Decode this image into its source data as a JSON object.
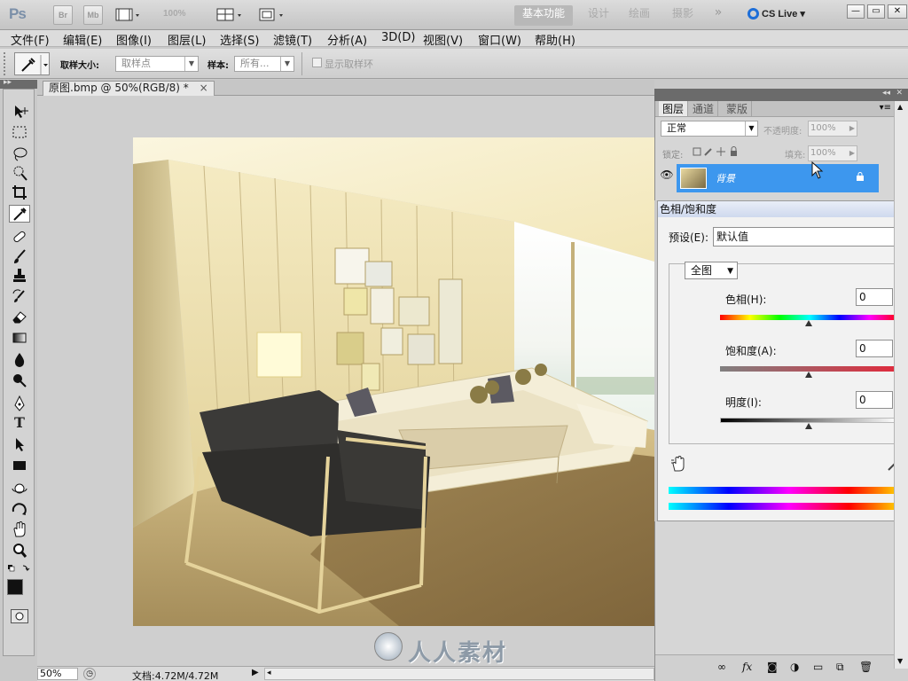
{
  "app": {
    "logo": "Ps"
  },
  "titlebar": {
    "bridge_label": "Br",
    "minibridge_label": "Mb",
    "zoom_value": "100%",
    "workspaces": [
      "基本功能",
      "设计",
      "绘画",
      "摄影"
    ],
    "more": "»",
    "cs_live": "CS Live",
    "window_controls": {
      "minimize": "—",
      "restore": "▭",
      "close": "✕"
    }
  },
  "menu": [
    "文件(F)",
    "编辑(E)",
    "图像(I)",
    "图层(L)",
    "选择(S)",
    "滤镜(T)",
    "分析(A)",
    "3D(D)",
    "视图(V)",
    "窗口(W)",
    "帮助(H)"
  ],
  "options": {
    "sample_size_label": "取样大小:",
    "sample_size_value": "取样点",
    "sample_label": "样本:",
    "sample_value": "所有...",
    "show_ring_label": "显示取样环"
  },
  "document": {
    "tab_title": "原图.bmp @ 50%(RGB/8) *",
    "close": "×",
    "watermark": "人人素材",
    "zoom": "50%",
    "doc_info": "文档:4.72M/4.72M"
  },
  "layers_panel": {
    "tabs": [
      "图层",
      "通道",
      "蒙版"
    ],
    "blend_mode": "正常",
    "opacity_label": "不透明度:",
    "opacity": "100%",
    "lock_label": "锁定:",
    "fill_label": "填充:",
    "fill": "100%",
    "layer_name": "背景"
  },
  "hue_sat": {
    "title": "色相/饱和度",
    "preset_label": "预设(E):",
    "preset_value": "默认值",
    "channel": "全图",
    "hue_label": "色相(H):",
    "hue": "0",
    "saturation_label": "饱和度(A):",
    "saturation": "0",
    "lightness_label": "明度(I):",
    "lightness": "0"
  },
  "colors": {
    "accent": "#3d97ee",
    "titlebar": "#c4c4c4",
    "selected_layer": "#3d97ee"
  }
}
